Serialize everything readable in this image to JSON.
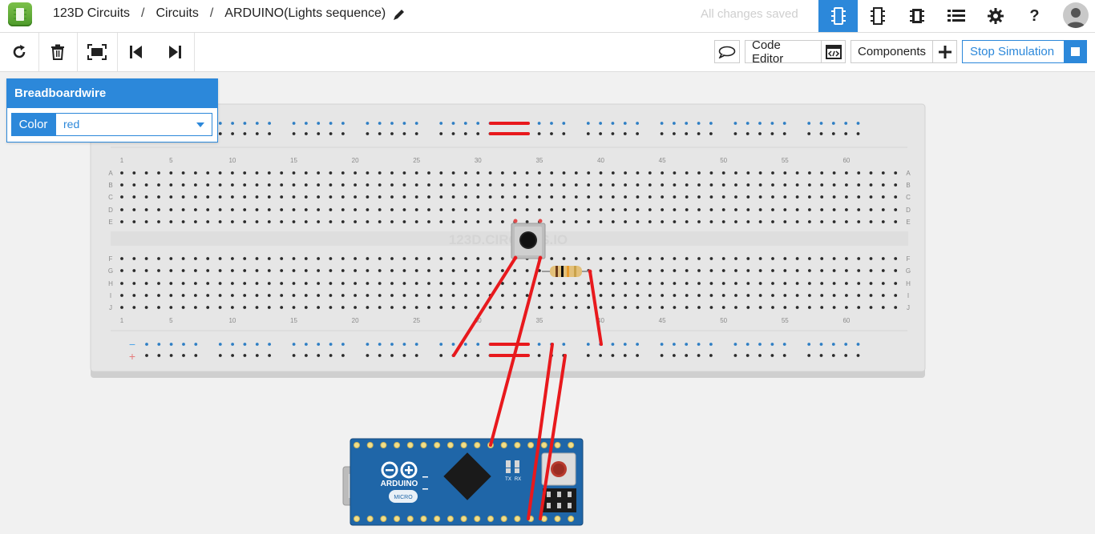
{
  "header": {
    "app_name": "123D Circuits",
    "crumb_circuits": "Circuits",
    "project_title": "ARDUINO(Lights sequence)",
    "separator": "/",
    "save_status": "All changes saved",
    "view_icons": [
      "breadboard-view-icon",
      "schematic-view-icon",
      "pcb-view-icon",
      "list-view-icon",
      "settings-icon",
      "help-icon"
    ],
    "help_label": "?"
  },
  "toolbar": {
    "tools": [
      "rotate-icon",
      "delete-icon",
      "fit-to-screen-icon",
      "step-back-icon",
      "step-forward-icon"
    ],
    "code_editor_label": "Code Editor",
    "components_label": "Components",
    "stop_simulation_label": "Stop Simulation"
  },
  "inspector": {
    "title": "Breadboardwire",
    "color_label": "Color",
    "color_value": "red"
  },
  "breadboard": {
    "watermark": "123D.CIRCUITS.IO",
    "row_labels": [
      "A",
      "B",
      "C",
      "D",
      "E",
      "F",
      "G",
      "H",
      "I",
      "J"
    ],
    "column_numbers": [
      "1",
      "5",
      "10",
      "15",
      "20",
      "25",
      "30",
      "35",
      "40",
      "45",
      "50",
      "55",
      "60"
    ],
    "rail_minus": "−",
    "rail_plus": "+"
  },
  "arduino": {
    "brand": "ARDUINO",
    "model": "MICRO",
    "tx": "TX",
    "rx": "RX"
  },
  "colors": {
    "accent": "#2c88da",
    "wire": "#e8191d",
    "board": "#1e5e9c",
    "breadboard": "#e4e4e4"
  }
}
